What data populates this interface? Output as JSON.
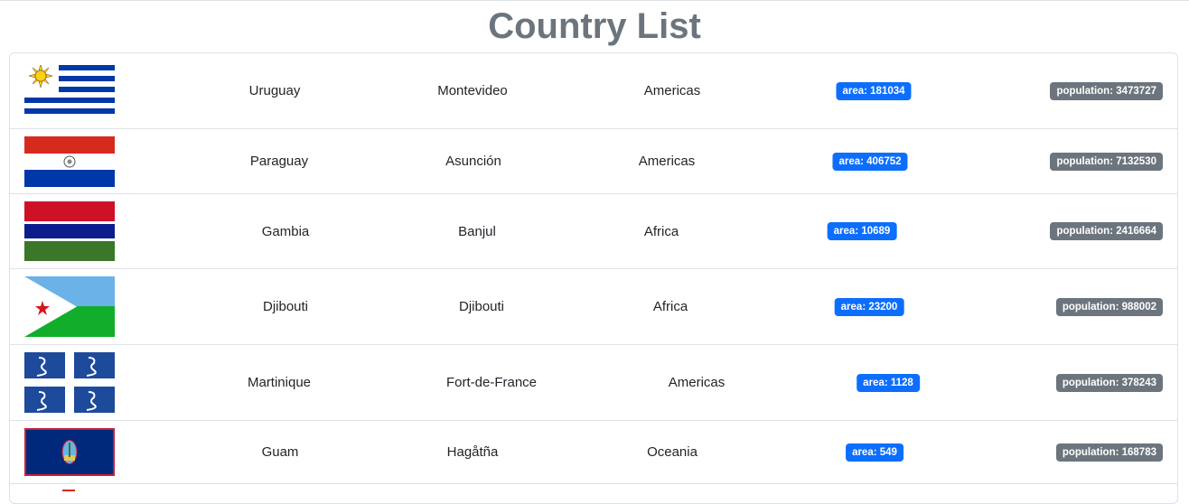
{
  "page": {
    "title": "Country List"
  },
  "countries": [
    {
      "name": "Uruguay",
      "capital": "Montevideo",
      "region": "Americas",
      "area": "area: 181034",
      "population": "population: 3473727",
      "flag": "uruguay-flag"
    },
    {
      "name": "Paraguay",
      "capital": "Asunción",
      "region": "Americas",
      "area": "area: 406752",
      "population": "population: 7132530",
      "flag": "paraguay-flag"
    },
    {
      "name": "Gambia",
      "capital": "Banjul",
      "region": "Africa",
      "area": "area: 10689",
      "population": "population: 2416664",
      "flag": "gambia-flag"
    },
    {
      "name": "Djibouti",
      "capital": "Djibouti",
      "region": "Africa",
      "area": "area: 23200",
      "population": "population: 988002",
      "flag": "djibouti-flag"
    },
    {
      "name": "Martinique",
      "capital": "Fort-de-France",
      "region": "Americas",
      "area": "area: 1128",
      "population": "population: 378243",
      "flag": "martinique-flag"
    },
    {
      "name": "Guam",
      "capital": "Hagåtña",
      "region": "Oceania",
      "area": "area: 549",
      "population": "population: 168783",
      "flag": "guam-flag"
    }
  ],
  "colors": {
    "area_badge": "#0d6efd",
    "population_badge": "#6c757d",
    "title": "#6c757d"
  }
}
